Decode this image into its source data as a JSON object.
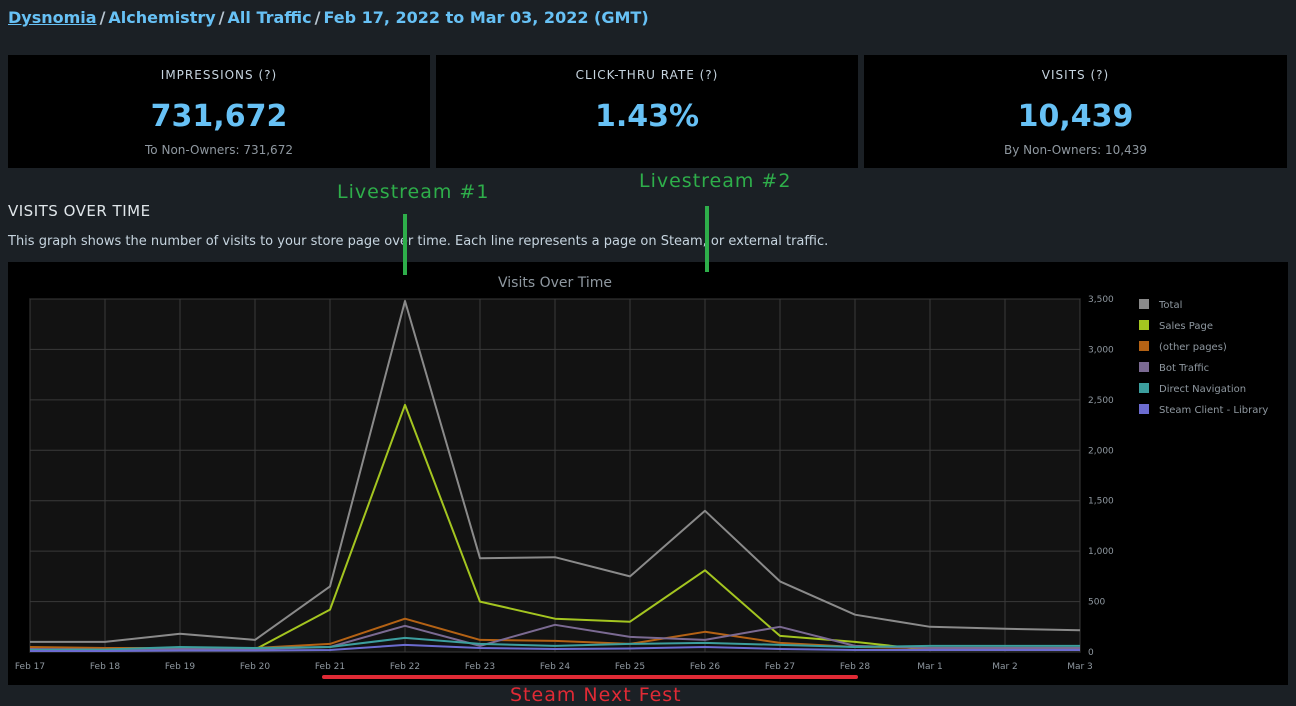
{
  "breadcrumb": {
    "items": [
      "Dysnomia",
      "Alchemistry",
      "All Traffic",
      "Feb 17, 2022 to Mar 03, 2022 (GMT)"
    ],
    "separator": "/"
  },
  "stats": {
    "impressions": {
      "label": "IMPRESSIONS (?)",
      "value": "731,672",
      "sub": "To Non-Owners: 731,672"
    },
    "ctr": {
      "label": "CLICK-THRU RATE (?)",
      "value": "1.43%"
    },
    "visits": {
      "label": "VISITS (?)",
      "value": "10,439",
      "sub": "By Non-Owners: 10,439"
    }
  },
  "section": {
    "title": "VISITS OVER TIME",
    "description": "This graph shows the number of visits to your store page over time. Each line represents a page on Steam, or external traffic."
  },
  "annotations": {
    "livestream1": "Livestream #1",
    "livestream2": "Livestream #2",
    "next_fest": "Steam Next Fest"
  },
  "colors": {
    "link": "#67c1f5",
    "annotation_green": "#2eae4a",
    "annotation_red": "#e02a35"
  },
  "chart_data": {
    "type": "line",
    "title": "Visits Over Time",
    "categories": [
      "Feb 17",
      "Feb 18",
      "Feb 19",
      "Feb 20",
      "Feb 21",
      "Feb 22",
      "Feb 23",
      "Feb 24",
      "Feb 25",
      "Feb 26",
      "Feb 27",
      "Feb 28",
      "Mar 1",
      "Mar 2",
      "Mar 3"
    ],
    "ylim": [
      0,
      3500
    ],
    "yticks": [
      0,
      500,
      1000,
      1500,
      2000,
      2500,
      3000,
      3500
    ],
    "ytick_labels": [
      "0",
      "500",
      "1,000",
      "1,500",
      "2,000",
      "2,500",
      "3,000",
      "3,500"
    ],
    "grid": true,
    "legend_position": "right",
    "series": [
      {
        "name": "Total",
        "color": "#8a8a8a",
        "values": [
          100,
          100,
          180,
          120,
          650,
          3480,
          930,
          940,
          750,
          1400,
          700,
          370,
          250,
          230,
          215
        ]
      },
      {
        "name": "Sales Page",
        "color": "#a4c520",
        "values": [
          20,
          15,
          20,
          25,
          420,
          2450,
          500,
          330,
          300,
          810,
          160,
          100,
          20,
          20,
          20
        ]
      },
      {
        "name": "(other pages)",
        "color": "#b46214",
        "values": [
          50,
          40,
          40,
          40,
          80,
          330,
          120,
          110,
          80,
          200,
          90,
          50,
          40,
          40,
          40
        ]
      },
      {
        "name": "Bot Traffic",
        "color": "#7b6a92",
        "values": [
          30,
          25,
          30,
          30,
          50,
          260,
          60,
          270,
          150,
          120,
          250,
          60,
          40,
          40,
          40
        ]
      },
      {
        "name": "Direct Navigation",
        "color": "#3c9e9e",
        "values": [
          20,
          25,
          50,
          40,
          50,
          140,
          80,
          60,
          80,
          90,
          70,
          50,
          60,
          60,
          60
        ]
      },
      {
        "name": "Steam Client - Library",
        "color": "#6c6cd0",
        "values": [
          10,
          10,
          15,
          15,
          20,
          70,
          40,
          30,
          35,
          50,
          30,
          20,
          20,
          20,
          20
        ]
      }
    ]
  }
}
